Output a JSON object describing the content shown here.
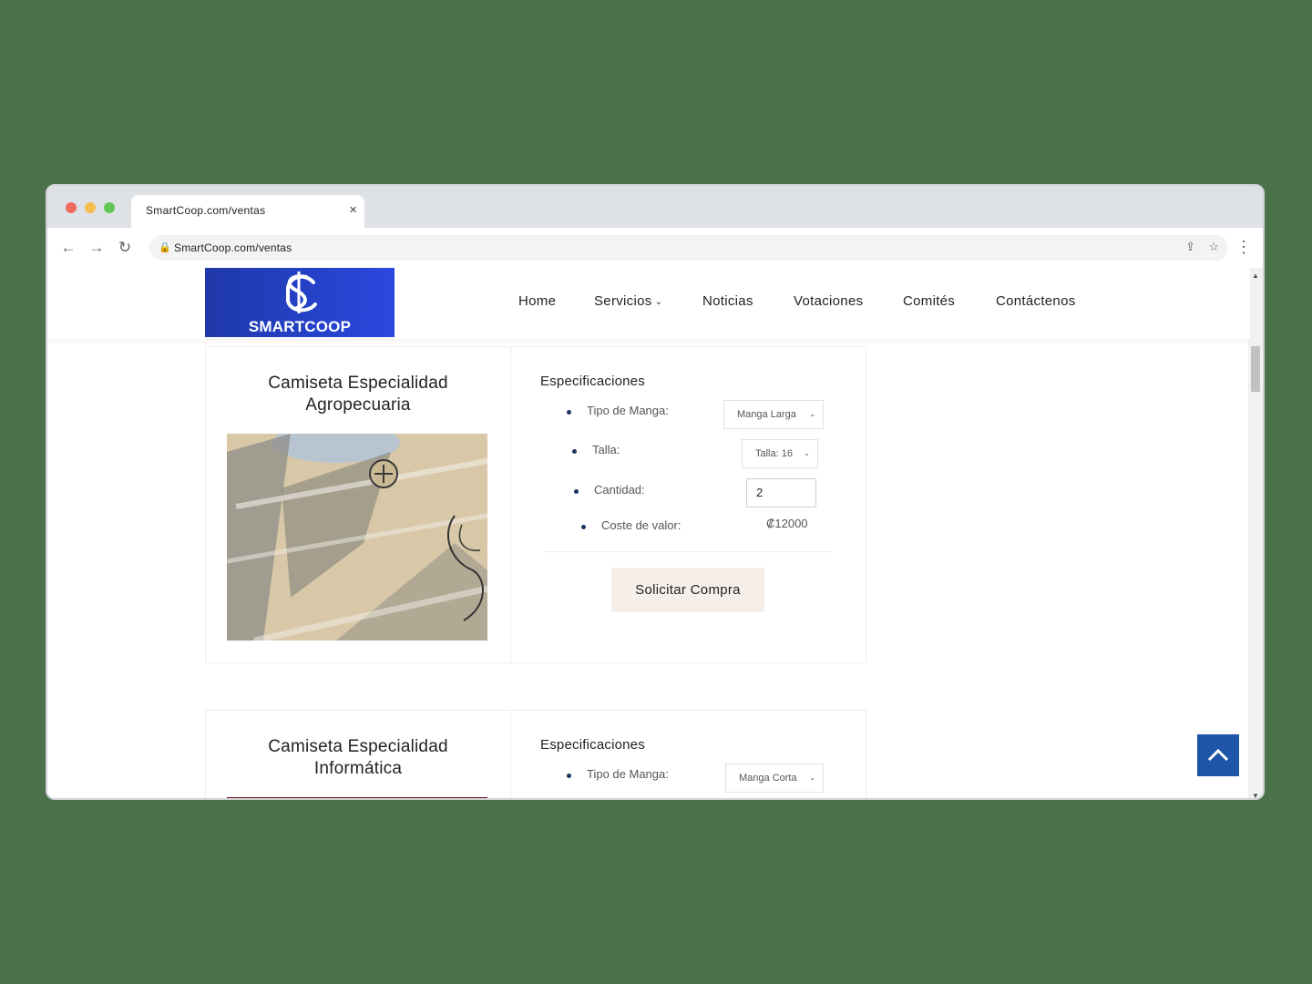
{
  "browser": {
    "tab_title": "SmartCoop.com/ventas",
    "tab_close": "×",
    "url": "SmartCoop.com/ventas",
    "nav": {
      "back": "←",
      "forward": "→",
      "reload": "↻",
      "menu": "⋮"
    },
    "icons": {
      "lock": "🔒",
      "share": "⇪",
      "star": "☆"
    }
  },
  "site": {
    "logo_text": "SMARTCOOP",
    "menu": [
      {
        "label": "Home"
      },
      {
        "label": "Servicios",
        "chevron": "⌄"
      },
      {
        "label": "Noticias"
      },
      {
        "label": "Votaciones"
      },
      {
        "label": "Comités"
      },
      {
        "label": "Contáctenos"
      }
    ]
  },
  "products": [
    {
      "title_line1": "Camiseta Especialidad",
      "title_line2": "Agropecuaria",
      "specs_heading": "Especificaciones",
      "manga_label": "Tipo de Manga:",
      "manga_value": "Manga Larga",
      "talla_label": "Talla:",
      "talla_value": "Talla: 16",
      "cantidad_label": "Cantidad:",
      "cantidad_value": "2",
      "coste_label": "Coste de valor:",
      "coste_value": "₡12000",
      "button": "Solicitar Compra"
    },
    {
      "title_line1": "Camiseta Especialidad",
      "title_line2": "Informática",
      "specs_heading": "Especificaciones",
      "manga_label": "Tipo de Manga:",
      "manga_value": "Manga Corta"
    }
  ],
  "scroll": {
    "up": "▲",
    "down": "▼",
    "to_top": "^"
  },
  "colors": {
    "background": "#4a7149",
    "logo_bg": "#2a48df",
    "bullet": "#1d3563",
    "to_top_button": "#1d56a8",
    "buy_button": "#f6efe9"
  }
}
